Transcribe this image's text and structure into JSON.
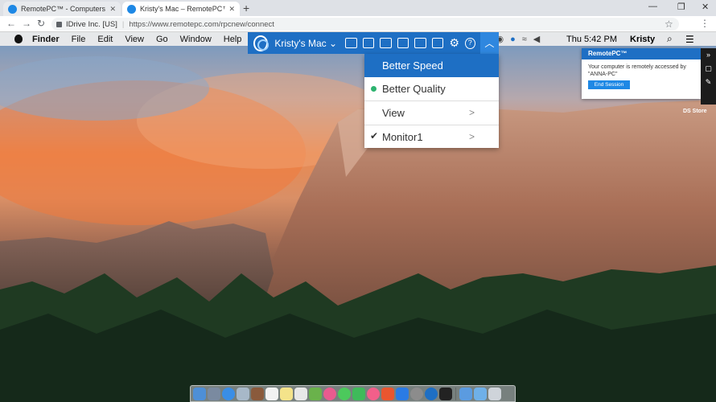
{
  "browser": {
    "tabs": [
      {
        "title": "RemotePC™ - Computers",
        "active": false
      },
      {
        "title": "Kristy's Mac – RemotePC™ Viewer",
        "active": true
      }
    ],
    "address": {
      "site_label": "IDrive Inc. [US]",
      "url": "https://www.remotepc.com/rpcnew/connect"
    }
  },
  "mac_menubar": {
    "items": [
      "Finder",
      "File",
      "Edit",
      "View",
      "Go",
      "Window",
      "Help"
    ],
    "clock": "Thu 5:42 PM",
    "user": "Kristy"
  },
  "remote_toolbar": {
    "machine_name": "Kristy's Mac",
    "colors": {
      "toolbar": "#1e6fc4",
      "accent": "#2db36f"
    }
  },
  "performance_menu": {
    "items": [
      {
        "label": "Better Speed",
        "state": "highlighted"
      },
      {
        "label": "Better Quality",
        "state": "selected"
      },
      {
        "label": "View",
        "submenu": true
      },
      {
        "label": "Monitor1",
        "submenu": true,
        "checked": true
      }
    ]
  },
  "notification": {
    "title": "RemotePC™",
    "message": "Your computer is remotely accessed by \"ANNA-PC\"",
    "end_button": "End Session"
  },
  "desktop": {
    "icon_label": "DS Store"
  }
}
